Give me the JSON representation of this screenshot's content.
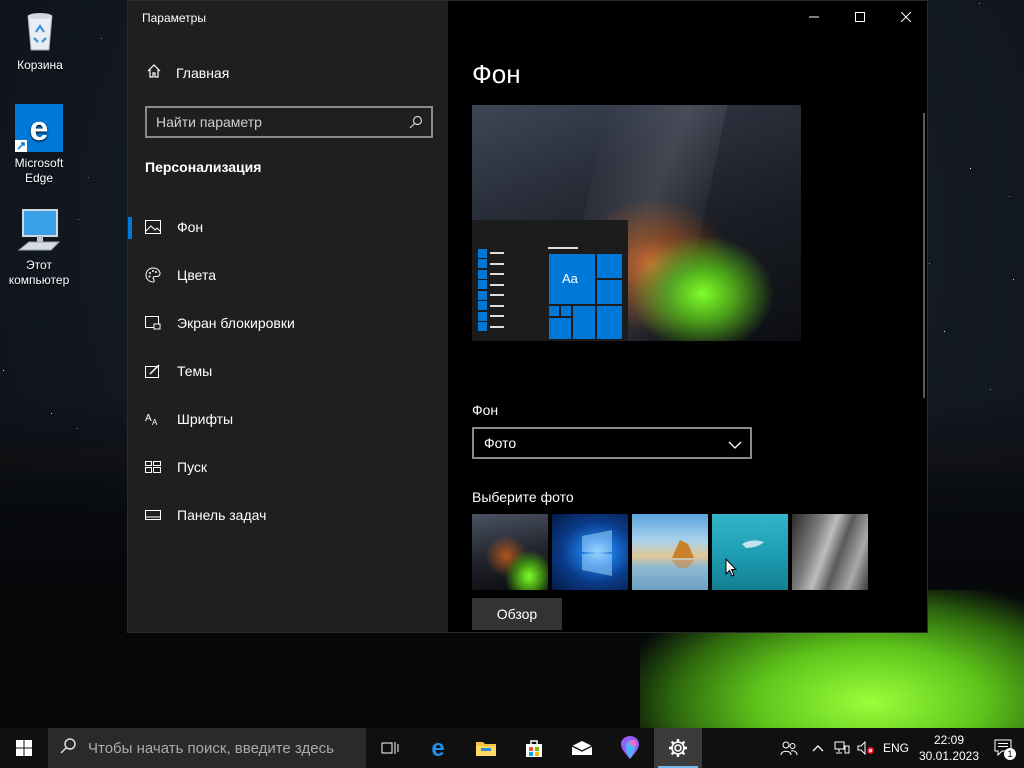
{
  "desktop": {
    "icons": [
      {
        "label": "Корзина"
      },
      {
        "label": "Microsoft Edge"
      },
      {
        "label": "Этот компьютер"
      }
    ]
  },
  "window": {
    "title": "Параметры",
    "controls": {
      "minimize": "—",
      "maximize": "☐",
      "close": "✕"
    }
  },
  "nav": {
    "home": "Главная",
    "search_placeholder": "Найти параметр",
    "section": "Персонализация",
    "items": [
      {
        "label": "Фон",
        "icon": "image-icon",
        "active": true
      },
      {
        "label": "Цвета",
        "icon": "palette-icon"
      },
      {
        "label": "Экран блокировки",
        "icon": "lock-screen-icon"
      },
      {
        "label": "Темы",
        "icon": "themes-icon"
      },
      {
        "label": "Шрифты",
        "icon": "fonts-icon"
      },
      {
        "label": "Пуск",
        "icon": "start-icon"
      },
      {
        "label": "Панель задач",
        "icon": "taskbar-icon"
      }
    ]
  },
  "main": {
    "title": "Фон",
    "preview_tile_text": "Aa",
    "background_label": "Фон",
    "background_value": "Фото",
    "choose_photo_label": "Выберите фото",
    "browse_button": "Обзор"
  },
  "taskbar": {
    "search_placeholder": "Чтобы начать поиск, введите здесь",
    "language": "ENG",
    "time": "22:09",
    "date": "30.01.2023",
    "notification_count": "1"
  },
  "colors": {
    "accent": "#0078d7",
    "nav_bg": "#1f1f1f",
    "content_bg": "#000000",
    "taskbar_bg": "#101010"
  }
}
